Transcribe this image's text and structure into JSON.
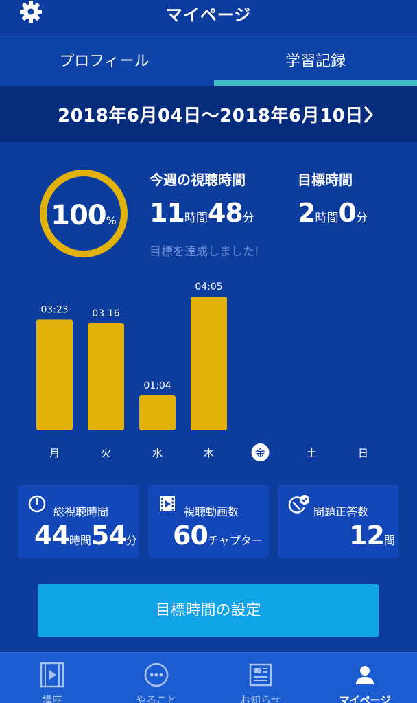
{
  "header": {
    "title": "マイページ",
    "settings_icon": "gear-icon"
  },
  "tabs": [
    {
      "label": "プロフィール",
      "active": false
    },
    {
      "label": "学習記録",
      "active": true
    }
  ],
  "date_range": {
    "label": "2018年6月04日〜2018年6月10日",
    "next_icon": "chevron-right-icon"
  },
  "progress": {
    "percent": 100,
    "value": "100",
    "unit": "%"
  },
  "weekly_watch": {
    "label": "今週の視聴時間",
    "hours": "11",
    "hours_unit": "時間",
    "minutes": "48",
    "minutes_unit": "分"
  },
  "goal_time": {
    "label": "目標時間",
    "hours": "2",
    "hours_unit": "時間",
    "minutes": "0",
    "minutes_unit": "分"
  },
  "achievement_message": "目標を達成しました!",
  "chart_data": {
    "type": "bar",
    "categories": [
      "月",
      "火",
      "水",
      "木",
      "金",
      "土",
      "日"
    ],
    "values": [
      203,
      196,
      64,
      245,
      null,
      null,
      null
    ],
    "value_labels": [
      "03:23",
      "03:16",
      "01:04",
      "04:05",
      "",
      "",
      ""
    ],
    "highlighted_category": "金",
    "bar_color": "#e1b20b",
    "ylim": [
      0,
      245
    ]
  },
  "stats": [
    {
      "icon": "clock-icon",
      "label": "総視聴時間",
      "hours": "44",
      "hours_unit": "時間",
      "minutes": "54",
      "minutes_unit": "分"
    },
    {
      "icon": "video-icon",
      "label": "視聴動画数",
      "count": "60",
      "count_unit": "チャプター"
    },
    {
      "icon": "checkmark-badge-icon",
      "label": "問題正答数",
      "count": "12",
      "count_unit": "問"
    }
  ],
  "goal_button": {
    "label": "目標時間の設定"
  },
  "bottom_nav": [
    {
      "label": "講座",
      "icon": "film-icon",
      "active": false
    },
    {
      "label": "やること",
      "icon": "dots-icon",
      "active": false
    },
    {
      "label": "お知らせ",
      "icon": "news-icon",
      "active": false
    },
    {
      "label": "マイページ",
      "icon": "person-icon",
      "active": true
    }
  ],
  "colors": {
    "background": "#0c3c9c",
    "accent_yellow": "#e1b20b",
    "tab_indicator": "#3fc1c4",
    "button": "#11a4e6"
  }
}
